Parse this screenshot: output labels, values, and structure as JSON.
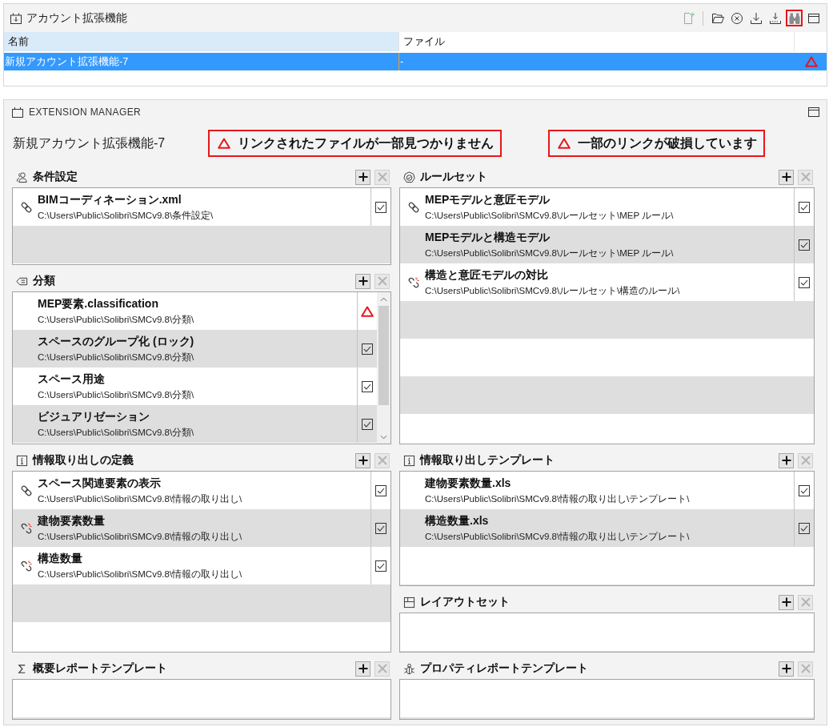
{
  "account_panel": {
    "title": "アカウント拡張機能",
    "toolbar": [
      {
        "kind": "new",
        "disabled": true,
        "highlighted": false
      },
      {
        "kind": "open",
        "disabled": false,
        "highlighted": false
      },
      {
        "kind": "remove",
        "disabled": false,
        "highlighted": false
      },
      {
        "kind": "import",
        "disabled": false,
        "highlighted": false
      },
      {
        "kind": "export",
        "disabled": false,
        "highlighted": false
      },
      {
        "kind": "extension",
        "disabled": false,
        "highlighted": true
      }
    ],
    "table": {
      "columns": [
        {
          "label": "名前",
          "selected": true
        },
        {
          "label": "ファイル",
          "selected": false
        }
      ],
      "rows": [
        {
          "name": "新規アカウント拡張機能-7",
          "file": "-",
          "missing": true,
          "selected": true
        }
      ]
    }
  },
  "extension_manager": {
    "title": "EXTENSION MANAGER",
    "account_name": "新規アカウント拡張機能-7",
    "warnings": [
      "リンクされたファイルが一部見つかりません",
      "一部のリンクが破損しています"
    ],
    "columns": [
      {
        "sections": [
          {
            "kind": "criteria",
            "title": "条件設定",
            "scrollbar": false,
            "buttons": [
              {
                "kind": "add",
                "disabled": false
              },
              {
                "kind": "remove",
                "disabled": true
              }
            ],
            "items": [
              {
                "name": "BIMコーディネーション.xml",
                "path": "C:\\Users\\Public\\Solibri\\SMCv9.8\\条件設定\\",
                "linked": true,
                "broken": false,
                "missing": false,
                "checked": true
              }
            ]
          },
          {
            "kind": "classification",
            "title": "分類",
            "scrollbar": true,
            "buttons": [
              {
                "kind": "add",
                "disabled": false
              },
              {
                "kind": "remove",
                "disabled": true
              }
            ],
            "items": [
              {
                "name": "MEP要素.classification",
                "path": "C:\\Users\\Public\\Solibri\\SMCv9.8\\分類\\",
                "linked": false,
                "broken": false,
                "missing": true
              },
              {
                "name": "スペースのグループ化 (ロック)",
                "path": "C:\\Users\\Public\\Solibri\\SMCv9.8\\分類\\",
                "linked": false,
                "broken": false,
                "missing": false,
                "checked": true
              },
              {
                "name": "スペース用途",
                "path": "C:\\Users\\Public\\Solibri\\SMCv9.8\\分類\\",
                "linked": false,
                "broken": false,
                "missing": false,
                "checked": true
              },
              {
                "name": "ビジュアリゼーション",
                "path": "C:\\Users\\Public\\Solibri\\SMCv9.8\\分類\\",
                "linked": false,
                "broken": false,
                "missing": false,
                "checked": true
              }
            ]
          },
          {
            "kind": "ito",
            "title": "情報取り出しの定義",
            "scrollbar": false,
            "buttons": [
              {
                "kind": "add",
                "disabled": false
              },
              {
                "kind": "remove",
                "disabled": true
              }
            ],
            "items": [
              {
                "name": "スペース関連要素の表示",
                "path": "C:\\Users\\Public\\Solibri\\SMCv9.8\\情報の取り出し\\",
                "linked": true,
                "broken": false,
                "missing": false,
                "checked": true
              },
              {
                "name": "建物要素数量",
                "path": "C:\\Users\\Public\\Solibri\\SMCv9.8\\情報の取り出し\\",
                "linked": false,
                "broken": true,
                "missing": false,
                "checked": true
              },
              {
                "name": "構造数量",
                "path": "C:\\Users\\Public\\Solibri\\SMCv9.8\\情報の取り出し\\",
                "linked": false,
                "broken": true,
                "missing": false,
                "checked": true
              }
            ]
          },
          {
            "kind": "summary",
            "title": "概要レポートテンプレート",
            "scrollbar": false,
            "buttons": [
              {
                "kind": "add",
                "disabled": false
              },
              {
                "kind": "remove",
                "disabled": true
              }
            ]
          }
        ]
      },
      {
        "sections": [
          {
            "kind": "ruleset",
            "title": "ルールセット",
            "scrollbar": false,
            "buttons": [
              {
                "kind": "add",
                "disabled": false
              },
              {
                "kind": "remove",
                "disabled": true
              }
            ],
            "items": [
              {
                "name": "MEPモデルと意匠モデル",
                "path": "C:\\Users\\Public\\Solibri\\SMCv9.8\\ルールセット\\MEP ルール\\",
                "linked": true,
                "broken": false,
                "missing": false,
                "checked": true
              },
              {
                "name": "MEPモデルと構造モデル",
                "path": "C:\\Users\\Public\\Solibri\\SMCv9.8\\ルールセット\\MEP ルール\\",
                "linked": false,
                "broken": false,
                "missing": false,
                "checked": true
              },
              {
                "name": "構造と意匠モデルの対比",
                "path": "C:\\Users\\Public\\Solibri\\SMCv9.8\\ルールセット\\構造のルール\\",
                "linked": false,
                "broken": true,
                "missing": false,
                "checked": true
              }
            ]
          },
          {
            "kind": "template",
            "title": "情報取り出しテンプレート",
            "scrollbar": false,
            "buttons": [
              {
                "kind": "add",
                "disabled": false
              },
              {
                "kind": "remove",
                "disabled": true
              }
            ],
            "items": [
              {
                "name": "建物要素数量.xls",
                "path": "C:\\Users\\Public\\Solibri\\SMCv9.8\\情報の取り出し\\テンプレート\\",
                "linked": false,
                "broken": false,
                "missing": false,
                "checked": true
              },
              {
                "name": "構造数量.xls",
                "path": "C:\\Users\\Public\\Solibri\\SMCv9.8\\情報の取り出し\\テンプレート\\",
                "linked": false,
                "broken": false,
                "missing": false,
                "checked": true
              }
            ]
          },
          {
            "kind": "layout",
            "title": "レイアウトセット",
            "scrollbar": false,
            "buttons": [
              {
                "kind": "add",
                "disabled": false
              },
              {
                "kind": "remove",
                "disabled": true
              }
            ]
          },
          {
            "kind": "property",
            "title": "プロパティレポートテンプレート",
            "scrollbar": false,
            "buttons": [
              {
                "kind": "add",
                "disabled": false
              },
              {
                "kind": "remove",
                "disabled": true
              }
            ]
          }
        ]
      }
    ]
  }
}
